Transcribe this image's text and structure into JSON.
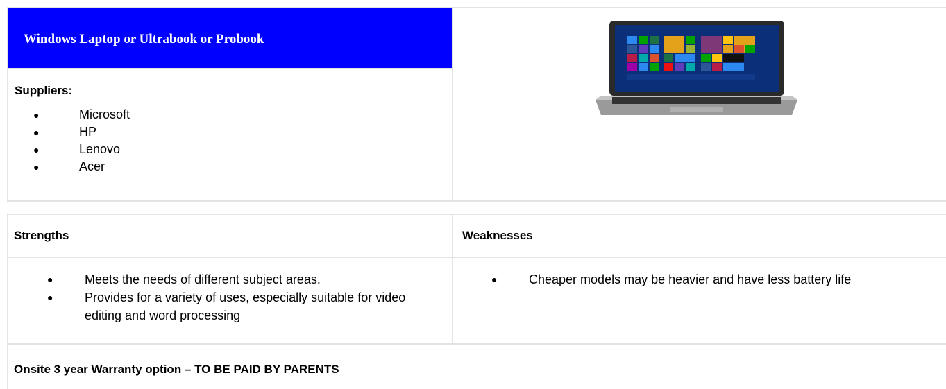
{
  "product": {
    "title": "Windows Laptop or Ultrabook or Probook",
    "title_bg": "#0000ff",
    "suppliers_label": "Suppliers:",
    "suppliers": [
      "Microsoft",
      "HP",
      "Lenovo",
      "Acer"
    ],
    "image": "laptop-image"
  },
  "evaluation": {
    "strengths_label": "Strengths",
    "weaknesses_label": "Weaknesses",
    "strengths": [
      "Meets the needs of different subject areas.",
      "Provides for a variety of uses, especially suitable for video editing and word processing"
    ],
    "weaknesses": [
      "Cheaper models may be heavier and have less battery life"
    ]
  },
  "warranty": "Onsite 3 year Warranty option – TO BE PAID BY PARENTS",
  "bullet_char": "●"
}
